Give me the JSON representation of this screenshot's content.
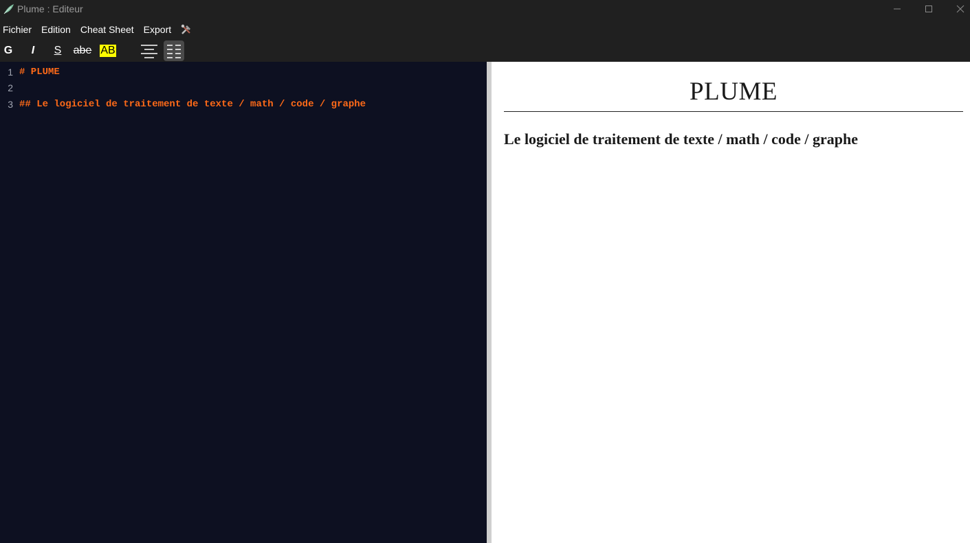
{
  "window": {
    "title": "Plume : Editeur",
    "app_icon": "feather-icon",
    "controls": [
      "minimize-icon",
      "maximize-icon",
      "close-icon"
    ]
  },
  "menubar": {
    "items": [
      {
        "label": "Fichier"
      },
      {
        "label": "Edition"
      },
      {
        "label": "Cheat Sheet"
      },
      {
        "label": "Export"
      }
    ],
    "tools_icon": "tools-icon"
  },
  "toolbar": {
    "bold": "G",
    "italic": "I",
    "underline": "S",
    "strikethrough": "abe",
    "highlight": "AB",
    "highlight_color": "#ffff00",
    "align_center_icon": "align-center-icon",
    "align_justify_icon": "align-justify-icon"
  },
  "editor": {
    "lines": [
      {
        "number": "1",
        "text": "# PLUME"
      },
      {
        "number": "2",
        "text": ""
      },
      {
        "number": "3",
        "text": "## Le logiciel de traitement de texte / math / code / graphe"
      }
    ],
    "text_color": "#ff6a18",
    "background": "#0d1021"
  },
  "preview": {
    "h1": "PLUME",
    "h2": "Le logiciel de traitement de texte / math / code / graphe"
  }
}
